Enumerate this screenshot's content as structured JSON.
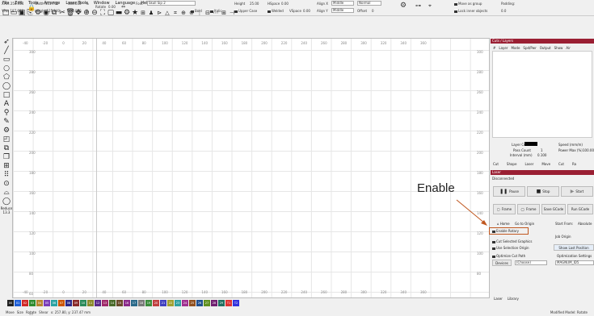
{
  "menu": [
    "File",
    "Edit",
    "Tools",
    "Arrange",
    "Laser Tools",
    "Window",
    "Language",
    "Help"
  ],
  "toolbar2": {
    "x_label": "XPos 254.954",
    "y_label": "YPos 187.688",
    "w_label": "Width 431.730",
    "h_label": "Height 125.340",
    "w_pct": "100.000",
    "h_pct": "100.000",
    "pct_unit": "%",
    "rotate_label": "Rotate",
    "rotate_val": "0.00",
    "font_label": "Font",
    "font_val": "Skull Sip 2",
    "height_label": "Height",
    "height_val": "25.00",
    "hspace_label": "HSpace",
    "hspace_val": "0.00",
    "vspace_label": "VSpace",
    "vspace_val": "0.00",
    "align_x_label": "Align X",
    "align_x_val": "Middle",
    "align_y_label": "Align Y",
    "align_y_val": "Middle",
    "normal_val": "Normal",
    "offset_label": "Offset",
    "offset_val": "0",
    "bold": "Bold",
    "italic": "Italic",
    "upper": "Upper Case",
    "welded": "Welded",
    "move_group": "Move as group",
    "lock_objects": "Lock inner objects",
    "padding_label": "Padding:",
    "padding_val": "0.0"
  },
  "ruler_top": [
    "-40",
    "-20",
    "0",
    "20",
    "40",
    "60",
    "80",
    "100",
    "120",
    "140",
    "160",
    "180",
    "200",
    "220",
    "240",
    "260",
    "280",
    "300",
    "320",
    "340",
    "360"
  ],
  "ruler_left": [
    "300",
    "280",
    "260",
    "240",
    "220",
    "200",
    "180",
    "160",
    "140",
    "120",
    "100",
    "80",
    "60",
    "40"
  ],
  "ruler_right": [
    "300",
    "280",
    "260",
    "240",
    "220",
    "200",
    "180",
    "160",
    "140",
    "120",
    "100",
    "80"
  ],
  "left_zoom": "Reduce",
  "left_zoom_val": "13.3",
  "cuts": {
    "title": "Cuts / Layers",
    "cols": [
      "#",
      "Layer",
      "Mode",
      "Spd/Pwr",
      "Output",
      "Show",
      "Air"
    ]
  },
  "layer_props": {
    "color": "Layer Color",
    "speed": "Speed (mm/m)",
    "pass": "Pass Count",
    "power": "Power Max (%)",
    "interval": "Interval (mm)",
    "interval_val": "0.100",
    "power_val": "100.00",
    "pass_val": "1"
  },
  "subtabs": [
    "Cut",
    "Shape",
    "Laser",
    "Move",
    "Cut",
    "Ra"
  ],
  "laser": {
    "title": "Laser",
    "status": "Disconnected",
    "pause": "Pause",
    "stop": "Stop",
    "start": "Start",
    "frame": "Frame",
    "frame2": "Frame",
    "save_gcode": "Save GCode",
    "run_gcode": "Run GCode",
    "home": "Home",
    "go_origin": "Go to Origin",
    "start_from": "Start From:",
    "absolute": "Absolute",
    "enable_rotary": "Enable Rotary",
    "job_origin": "Job Origin",
    "cut_selected": "Cut Selected Graphics",
    "use_selection": "Use Selection Origin",
    "show_last": "Show Last Position",
    "optimize": "Optimize Cut Path",
    "opt_settings": "Optimization Settings",
    "devices": "Devices",
    "choose": "(Choose)",
    "device_name": "MAGNUM_ID5"
  },
  "bottom_tabs": [
    "Laser",
    "Library"
  ],
  "callout": "Enable",
  "palette": [
    "00",
    "01",
    "02",
    "03",
    "04",
    "05",
    "06",
    "07",
    "08",
    "09",
    "10",
    "11",
    "12",
    "13",
    "14",
    "15",
    "16",
    "17",
    "18",
    "19",
    "20",
    "21",
    "22",
    "23",
    "24",
    "25",
    "26",
    "27",
    "28",
    "29",
    "T1",
    "T2"
  ],
  "palette_colors": [
    "#222222",
    "#1f5fd6",
    "#d12828",
    "#2e8b2e",
    "#b7862e",
    "#7a3db8",
    "#2aa3a3",
    "#cc5500",
    "#2a2a8a",
    "#8a2a2a",
    "#2a8a5a",
    "#8a8a2a",
    "#5a2a8a",
    "#a02a6a",
    "#4a6a2a",
    "#6a4a2a",
    "#8a2a8a",
    "#2a6a8a",
    "#7a7a7a",
    "#3c8c3c",
    "#c04040",
    "#4040c0",
    "#a0a030",
    "#30a0a0",
    "#a03090",
    "#905020",
    "#205090",
    "#609020",
    "#702070",
    "#207060",
    "#dd3333",
    "#3333dd"
  ],
  "status": {
    "move": "Move",
    "size": "Size",
    "rotate": "Rotate",
    "shear": "Shear",
    "coords": "x: 257.80, y: 237.47 mm",
    "right": "Modified Model: Rotate"
  }
}
